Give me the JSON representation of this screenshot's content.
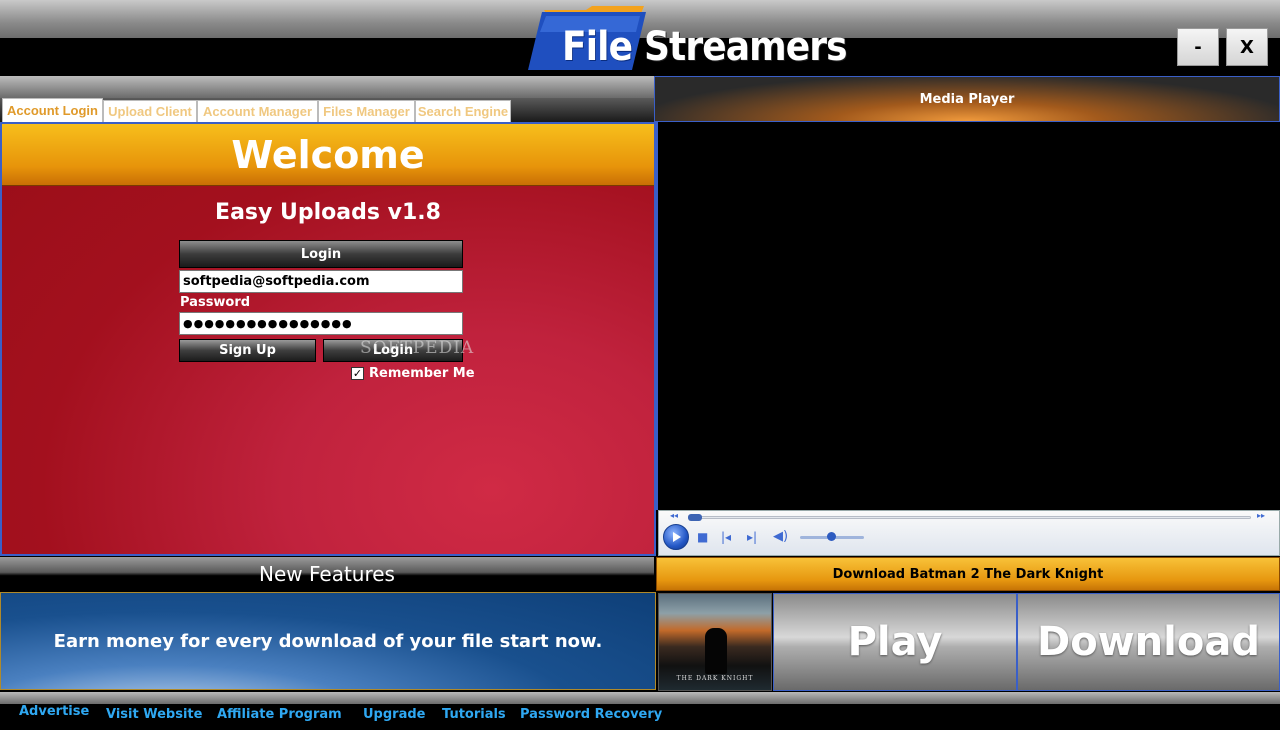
{
  "app": {
    "logo_word1": "File",
    "logo_word2": "Streamers",
    "minimize_label": "-",
    "close_label": "X"
  },
  "tabs": [
    {
      "label": "Account Login",
      "active": true
    },
    {
      "label": "Upload Client",
      "active": false
    },
    {
      "label": "Account Manager",
      "active": false
    },
    {
      "label": "Files Manager",
      "active": false
    },
    {
      "label": "Search Engine",
      "active": false
    }
  ],
  "login": {
    "welcome": "Welcome",
    "subtitle": "Easy Uploads v1.8",
    "header": "Login",
    "email_value": "softpedia@softpedia.com",
    "password_label": "Password",
    "password_value": "●●●●●●●●●●●●●●●●",
    "signup_label": "Sign Up",
    "login_label": "Login",
    "remember_label": "Remember Me",
    "remember_checked": true,
    "watermark": "SOFTPEDIA"
  },
  "media_player": {
    "title": "Media Player"
  },
  "features": {
    "heading": "New Features",
    "banner_text": "Earn money for every download of your file start now."
  },
  "download": {
    "title": "Download Batman 2 The Dark Knight",
    "play_label": "Play",
    "download_label": "Download",
    "poster_caption": "THE DARK KNIGHT"
  },
  "footer": {
    "links": [
      "Advertise",
      "Visit Website",
      "Affiliate Program",
      "Upgrade",
      "Tutorials",
      "Password Recovery"
    ]
  },
  "colors": {
    "accent_orange": "#e7940a",
    "panel_red": "#a3101e",
    "link_blue": "#2fa8f2",
    "border_blue": "#3a5fc8"
  }
}
